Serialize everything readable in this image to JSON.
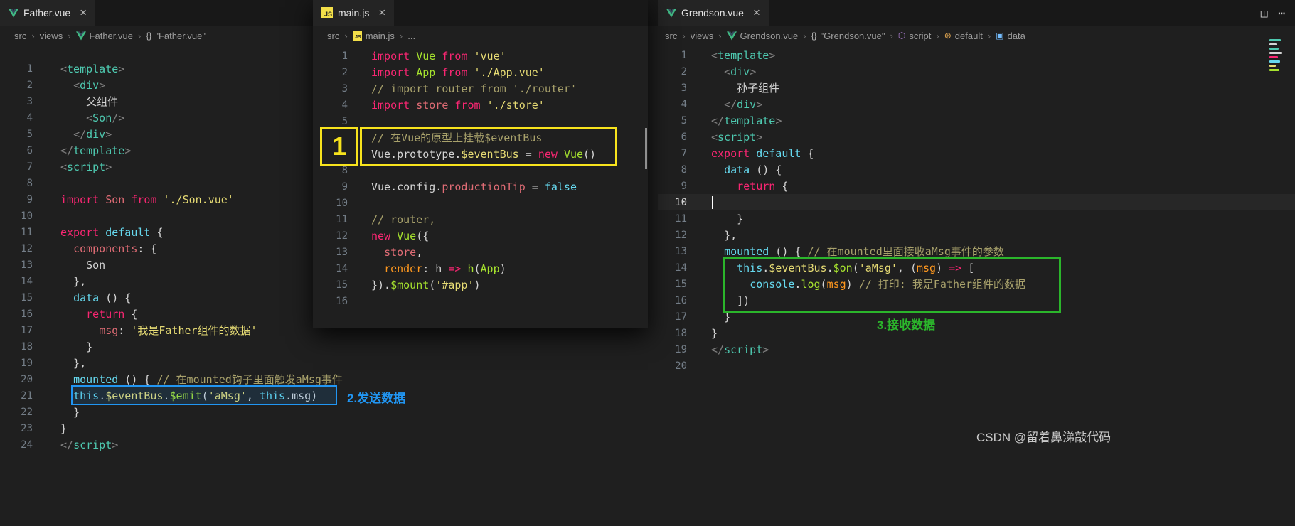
{
  "watermark": "CSDN @留着鼻涕敲代码",
  "icons": {
    "close": "×",
    "chevron": "›",
    "split_editor": "◫",
    "more_actions": "⋯",
    "braces": "{}",
    "module": "⬡",
    "property": "⊛",
    "field": "▣",
    "js_badge": "JS"
  },
  "syntax_colors": {
    "t": "#4ec9b0",
    "p": "#808080",
    "w": "#d4d4d4",
    "k": "#f92672",
    "s": "#e6db74",
    "f": "#a6e22e",
    "r": "#e06c75",
    "b": "#66d9ef",
    "o": "#fd971f",
    "c": "#a8a16b"
  },
  "annotations": {
    "step1": {
      "label": "1",
      "color": "#f7e31d"
    },
    "step2": {
      "label": "2.发送数据",
      "color": "#2196f3"
    },
    "step3": {
      "label": "3.接收数据",
      "color": "#2bb52b"
    }
  },
  "minimap": [
    [
      "#4ec9b0",
      16
    ],
    [
      "#d4d4d4",
      10
    ],
    [
      "#4ec9b0",
      13
    ],
    [
      "#d4d4d4",
      18
    ],
    [
      "#f92672",
      12
    ],
    [
      "#66d9ef",
      15
    ],
    [
      "#e6db74",
      9
    ],
    [
      "#a6e22e",
      14
    ]
  ],
  "panes": {
    "father": {
      "tab": {
        "label": "Father.vue"
      },
      "breadcrumb": [
        {
          "label": "src"
        },
        {
          "label": "views"
        },
        {
          "label": "Father.vue",
          "icon": "vue"
        },
        {
          "label": "\"Father.vue\"",
          "icon": "braces"
        }
      ],
      "code": [
        {
          "n": 1,
          "t": [
            [
              "p",
              "<"
            ],
            [
              "t",
              "template"
            ],
            [
              "p",
              ">"
            ]
          ]
        },
        {
          "n": 2,
          "t": [
            [
              "w",
              "  "
            ],
            [
              "p",
              "<"
            ],
            [
              "t",
              "div"
            ],
            [
              "p",
              ">"
            ]
          ]
        },
        {
          "n": 3,
          "t": [
            [
              "w",
              "    父组件"
            ]
          ]
        },
        {
          "n": 4,
          "t": [
            [
              "w",
              "    "
            ],
            [
              "p",
              "<"
            ],
            [
              "t",
              "Son"
            ],
            [
              "p",
              "/>"
            ]
          ]
        },
        {
          "n": 5,
          "t": [
            [
              "w",
              "  "
            ],
            [
              "p",
              "</"
            ],
            [
              "t",
              "div"
            ],
            [
              "p",
              ">"
            ]
          ]
        },
        {
          "n": 6,
          "t": [
            [
              "p",
              "</"
            ],
            [
              "t",
              "template"
            ],
            [
              "p",
              ">"
            ]
          ]
        },
        {
          "n": 7,
          "t": [
            [
              "p",
              "<"
            ],
            [
              "t",
              "script"
            ],
            [
              "p",
              ">"
            ]
          ]
        },
        {
          "n": 8,
          "t": []
        },
        {
          "n": 9,
          "t": [
            [
              "k",
              "import"
            ],
            [
              "w",
              " "
            ],
            [
              "r",
              "Son"
            ],
            [
              "w",
              " "
            ],
            [
              "k",
              "from"
            ],
            [
              "w",
              " "
            ],
            [
              "s",
              "'./Son.vue'"
            ]
          ]
        },
        {
          "n": 10,
          "t": []
        },
        {
          "n": 11,
          "t": [
            [
              "k",
              "export"
            ],
            [
              "w",
              " "
            ],
            [
              "b",
              "default"
            ],
            [
              "w",
              " {"
            ]
          ]
        },
        {
          "n": 12,
          "t": [
            [
              "w",
              "  "
            ],
            [
              "r",
              "components"
            ],
            [
              "w",
              ": {"
            ]
          ]
        },
        {
          "n": 13,
          "t": [
            [
              "w",
              "    Son"
            ]
          ]
        },
        {
          "n": 14,
          "t": [
            [
              "w",
              "  },"
            ]
          ]
        },
        {
          "n": 15,
          "t": [
            [
              "w",
              "  "
            ],
            [
              "b",
              "data"
            ],
            [
              "w",
              " () {"
            ]
          ]
        },
        {
          "n": 16,
          "t": [
            [
              "w",
              "    "
            ],
            [
              "k",
              "return"
            ],
            [
              "w",
              " {"
            ]
          ]
        },
        {
          "n": 17,
          "t": [
            [
              "w",
              "      "
            ],
            [
              "r",
              "msg"
            ],
            [
              "w",
              ": "
            ],
            [
              "s",
              "'我是Father组件的数据'"
            ]
          ]
        },
        {
          "n": 18,
          "t": [
            [
              "w",
              "    }"
            ]
          ]
        },
        {
          "n": 19,
          "t": [
            [
              "w",
              "  },"
            ]
          ]
        },
        {
          "n": 20,
          "t": [
            [
              "w",
              "  "
            ],
            [
              "b",
              "mounted"
            ],
            [
              "w",
              " () { "
            ],
            [
              "c",
              "// 在mounted钩子里面触发aMsg事件"
            ]
          ]
        },
        {
          "n": 21,
          "t": [
            [
              "w",
              "  "
            ],
            [
              "b",
              "this"
            ],
            [
              "w",
              "."
            ],
            [
              "s",
              "$eventBus"
            ],
            [
              "w",
              "."
            ],
            [
              "f",
              "$emit"
            ],
            [
              "w",
              "("
            ],
            [
              "s",
              "'aMsg'"
            ],
            [
              "w",
              ", "
            ],
            [
              "b",
              "this"
            ],
            [
              "w",
              ".msg)"
            ]
          ]
        },
        {
          "n": 22,
          "t": [
            [
              "w",
              "  }"
            ]
          ]
        },
        {
          "n": 23,
          "t": [
            [
              "w",
              "}"
            ]
          ]
        },
        {
          "n": 24,
          "t": [
            [
              "p",
              "</"
            ],
            [
              "t",
              "script"
            ],
            [
              "p",
              ">"
            ]
          ]
        }
      ]
    },
    "main": {
      "tab": {
        "label": "main.js"
      },
      "breadcrumb": [
        {
          "label": "src"
        },
        {
          "label": "main.js",
          "icon": "js"
        },
        {
          "label": "..."
        }
      ],
      "code": [
        {
          "n": 1,
          "t": [
            [
              "k",
              "import"
            ],
            [
              "w",
              " "
            ],
            [
              "f",
              "Vue"
            ],
            [
              "w",
              " "
            ],
            [
              "k",
              "from"
            ],
            [
              "w",
              " "
            ],
            [
              "s",
              "'vue'"
            ]
          ]
        },
        {
          "n": 2,
          "t": [
            [
              "k",
              "import"
            ],
            [
              "w",
              " "
            ],
            [
              "f",
              "App"
            ],
            [
              "w",
              " "
            ],
            [
              "k",
              "from"
            ],
            [
              "w",
              " "
            ],
            [
              "s",
              "'./App.vue'"
            ]
          ]
        },
        {
          "n": 3,
          "t": [
            [
              "c",
              "// import router from './router'"
            ]
          ]
        },
        {
          "n": 4,
          "t": [
            [
              "k",
              "import"
            ],
            [
              "w",
              " "
            ],
            [
              "r",
              "store"
            ],
            [
              "w",
              " "
            ],
            [
              "k",
              "from"
            ],
            [
              "w",
              " "
            ],
            [
              "s",
              "'./store'"
            ]
          ]
        },
        {
          "n": 5,
          "t": []
        },
        {
          "n": 6,
          "t": [
            [
              "c",
              "// 在Vue的原型上挂载$eventBus"
            ]
          ]
        },
        {
          "n": 7,
          "t": [
            [
              "w",
              "Vue.prototype."
            ],
            [
              "s",
              "$eventBus"
            ],
            [
              "w",
              " = "
            ],
            [
              "k",
              "new"
            ],
            [
              "w",
              " "
            ],
            [
              "f",
              "Vue"
            ],
            [
              "w",
              "()"
            ]
          ]
        },
        {
          "n": 8,
          "t": []
        },
        {
          "n": 9,
          "t": [
            [
              "w",
              "Vue.config."
            ],
            [
              "r",
              "productionTip"
            ],
            [
              "w",
              " = "
            ],
            [
              "b",
              "false"
            ]
          ]
        },
        {
          "n": 10,
          "t": []
        },
        {
          "n": 11,
          "t": [
            [
              "c",
              "// router,"
            ]
          ]
        },
        {
          "n": 12,
          "t": [
            [
              "k",
              "new"
            ],
            [
              "w",
              " "
            ],
            [
              "f",
              "Vue"
            ],
            [
              "w",
              "({"
            ]
          ]
        },
        {
          "n": 13,
          "t": [
            [
              "w",
              "  "
            ],
            [
              "r",
              "store"
            ],
            [
              "w",
              ","
            ]
          ]
        },
        {
          "n": 14,
          "t": [
            [
              "w",
              "  "
            ],
            [
              "o",
              "render"
            ],
            [
              "w",
              ": h "
            ],
            [
              "k",
              "=>"
            ],
            [
              "w",
              " "
            ],
            [
              "f",
              "h"
            ],
            [
              "w",
              "("
            ],
            [
              "f",
              "App"
            ],
            [
              "w",
              ")"
            ]
          ]
        },
        {
          "n": 15,
          "t": [
            [
              "w",
              "})."
            ],
            [
              "f",
              "$mount"
            ],
            [
              "w",
              "("
            ],
            [
              "s",
              "'#app'"
            ],
            [
              "w",
              ")"
            ]
          ]
        },
        {
          "n": 16,
          "t": []
        }
      ]
    },
    "grendson": {
      "tab": {
        "label": "Grendson.vue"
      },
      "breadcrumb": [
        {
          "label": "src"
        },
        {
          "label": "views"
        },
        {
          "label": "Grendson.vue",
          "icon": "vue"
        },
        {
          "label": "\"Grendson.vue\"",
          "icon": "braces"
        },
        {
          "label": "script",
          "icon": "module"
        },
        {
          "label": "default",
          "icon": "property"
        },
        {
          "label": "data",
          "icon": "field"
        }
      ],
      "code": [
        {
          "n": 1,
          "t": [
            [
              "p",
              "<"
            ],
            [
              "t",
              "template"
            ],
            [
              "p",
              ">"
            ]
          ]
        },
        {
          "n": 2,
          "t": [
            [
              "w",
              "  "
            ],
            [
              "p",
              "<"
            ],
            [
              "t",
              "div"
            ],
            [
              "p",
              ">"
            ]
          ]
        },
        {
          "n": 3,
          "t": [
            [
              "w",
              "    孙子组件"
            ]
          ]
        },
        {
          "n": 4,
          "t": [
            [
              "w",
              "  "
            ],
            [
              "p",
              "</"
            ],
            [
              "t",
              "div"
            ],
            [
              "p",
              ">"
            ]
          ]
        },
        {
          "n": 5,
          "t": [
            [
              "p",
              "</"
            ],
            [
              "t",
              "template"
            ],
            [
              "p",
              ">"
            ]
          ]
        },
        {
          "n": 6,
          "t": [
            [
              "p",
              "<"
            ],
            [
              "t",
              "script"
            ],
            [
              "p",
              ">"
            ]
          ]
        },
        {
          "n": 7,
          "t": [
            [
              "k",
              "export"
            ],
            [
              "w",
              " "
            ],
            [
              "b",
              "default"
            ],
            [
              "w",
              " {"
            ]
          ]
        },
        {
          "n": 8,
          "t": [
            [
              "w",
              "  "
            ],
            [
              "b",
              "data"
            ],
            [
              "w",
              " () {"
            ]
          ]
        },
        {
          "n": 9,
          "t": [
            [
              "w",
              "    "
            ],
            [
              "k",
              "return"
            ],
            [
              "w",
              " {"
            ]
          ]
        },
        {
          "n": 10,
          "t": [],
          "active": true,
          "cursor": true
        },
        {
          "n": 11,
          "t": [
            [
              "w",
              "    }"
            ]
          ]
        },
        {
          "n": 12,
          "t": [
            [
              "w",
              "  },"
            ]
          ]
        },
        {
          "n": 13,
          "t": [
            [
              "w",
              "  "
            ],
            [
              "b",
              "mounted"
            ],
            [
              "w",
              " () { "
            ],
            [
              "c",
              "// 在mounted里面接收aMsg事件的参数"
            ]
          ]
        },
        {
          "n": 14,
          "t": [
            [
              "w",
              "    "
            ],
            [
              "b",
              "this"
            ],
            [
              "w",
              "."
            ],
            [
              "s",
              "$eventBus"
            ],
            [
              "w",
              "."
            ],
            [
              "f",
              "$on"
            ],
            [
              "w",
              "("
            ],
            [
              "s",
              "'aMsg'"
            ],
            [
              "w",
              ", ("
            ],
            [
              "o",
              "msg"
            ],
            [
              "w",
              ") "
            ],
            [
              "k",
              "=>"
            ],
            [
              "w",
              " ["
            ]
          ]
        },
        {
          "n": 15,
          "t": [
            [
              "w",
              "      "
            ],
            [
              "b",
              "console"
            ],
            [
              "w",
              "."
            ],
            [
              "f",
              "log"
            ],
            [
              "w",
              "("
            ],
            [
              "o",
              "msg"
            ],
            [
              "w",
              ") "
            ],
            [
              "c",
              "// 打印: 我是Father组件的数据"
            ]
          ]
        },
        {
          "n": 16,
          "t": [
            [
              "w",
              "    ])"
            ]
          ]
        },
        {
          "n": 17,
          "t": [
            [
              "w",
              "  }"
            ]
          ]
        },
        {
          "n": 18,
          "t": [
            [
              "w",
              "}"
            ]
          ]
        },
        {
          "n": 19,
          "t": [
            [
              "p",
              "</"
            ],
            [
              "t",
              "script"
            ],
            [
              "p",
              ">"
            ]
          ]
        },
        {
          "n": 20,
          "t": []
        }
      ]
    }
  }
}
